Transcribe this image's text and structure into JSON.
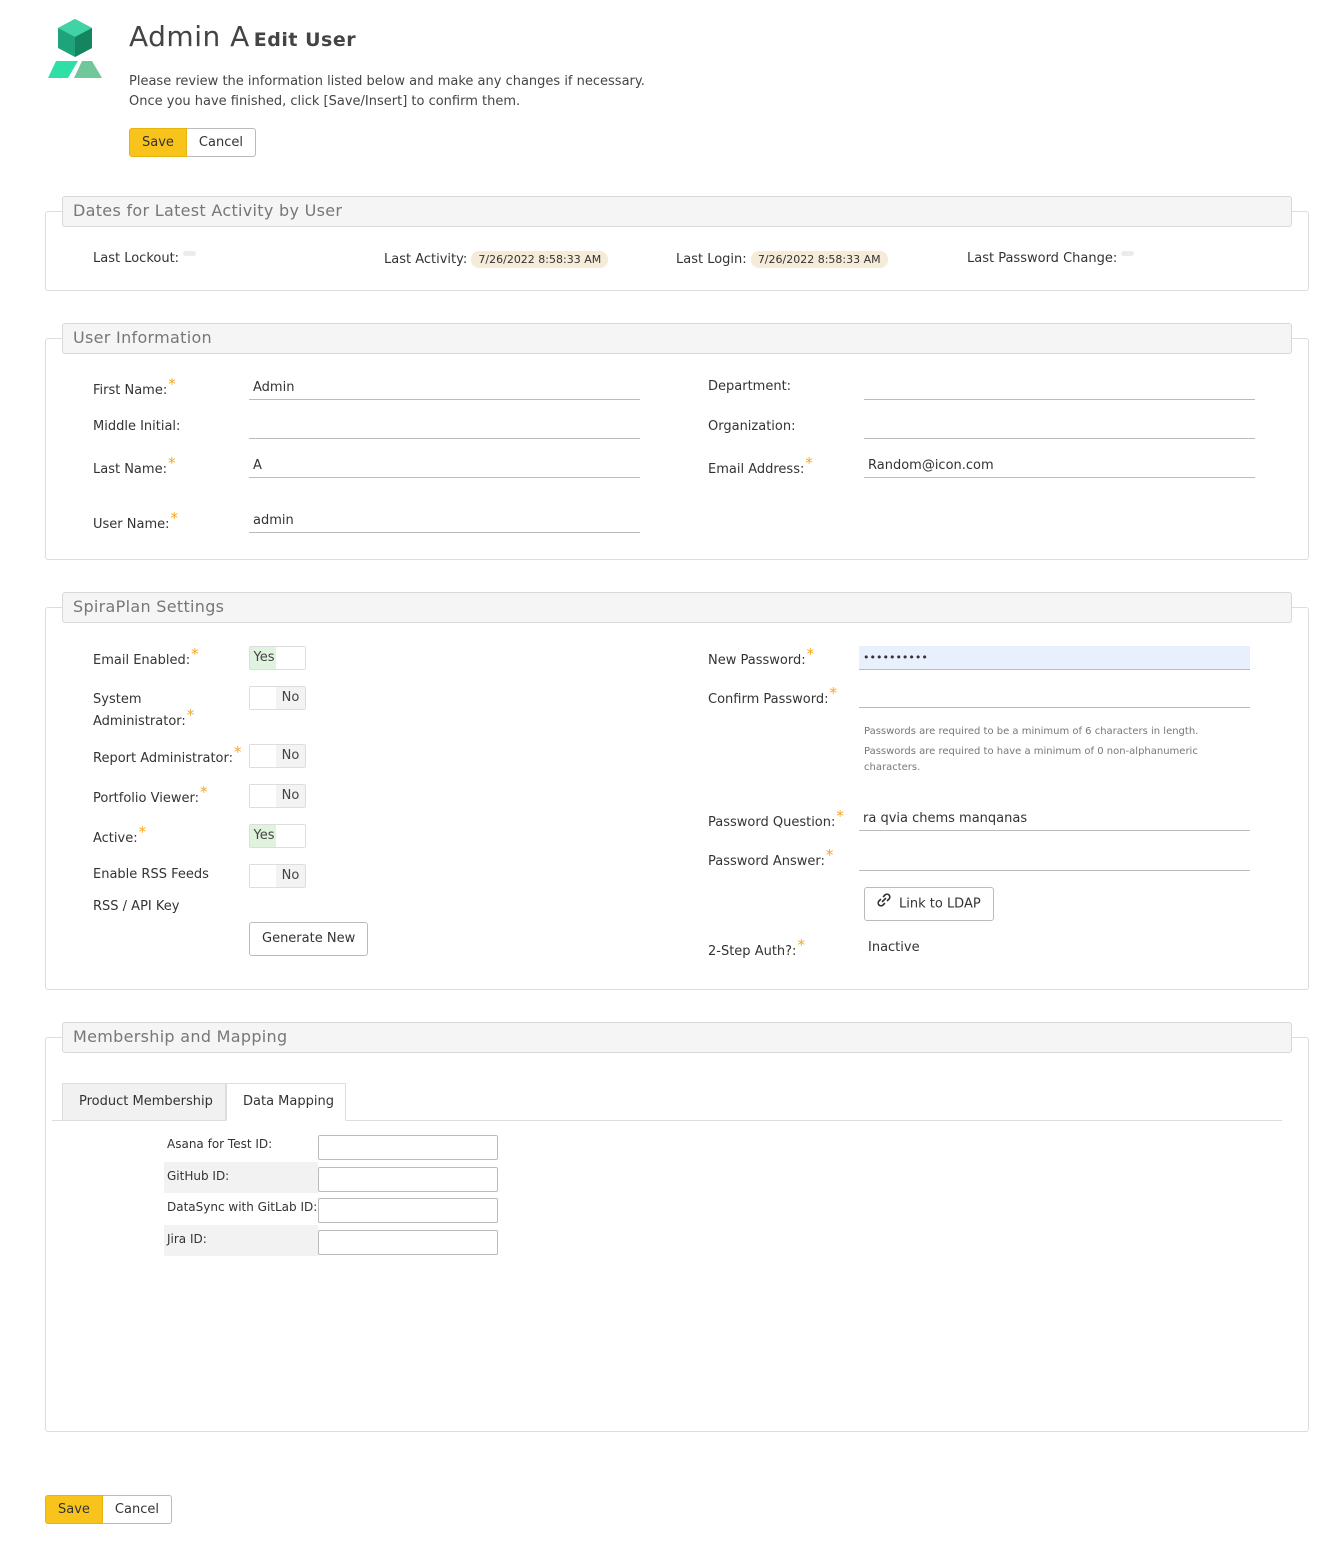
{
  "header": {
    "title": "Admin A",
    "subtitle": "Edit User",
    "intro_line1": "Please review the information listed below and make any changes if necessary.",
    "intro_line2": "Once you have finished, click [Save/Insert] to confirm them.",
    "save_label": "Save",
    "cancel_label": "Cancel"
  },
  "colors": {
    "accent": "#f8c41c",
    "required": "#f5a623",
    "logo_green": "#2fc19a"
  },
  "activity": {
    "legend": "Dates for Latest Activity by User",
    "last_lockout_label": "Last Lockout:",
    "last_activity_label": "Last Activity:",
    "last_activity_value": "7/26/2022 8:58:33 AM",
    "last_login_label": "Last Login:",
    "last_login_value": "7/26/2022 8:58:33 AM",
    "last_password_change_label": "Last Password Change:"
  },
  "user_info": {
    "legend": "User Information",
    "first_name_label": "First Name:",
    "first_name_value": "Admin",
    "middle_initial_label": "Middle Initial:",
    "middle_initial_value": "",
    "last_name_label": "Last Name:",
    "last_name_value": "A",
    "user_name_label": "User Name:",
    "user_name_value": "admin",
    "department_label": "Department:",
    "department_value": "",
    "organization_label": "Organization:",
    "organization_value": "",
    "email_label": "Email Address:",
    "email_value": "Random@icon.com"
  },
  "settings": {
    "legend": "SpiraPlan Settings",
    "email_enabled_label": "Email Enabled:",
    "email_enabled_value": "Yes",
    "sysadmin_label_1": "System",
    "sysadmin_label_2": "Administrator:",
    "sysadmin_value": "No",
    "report_admin_label": "Report Administrator:",
    "report_admin_value": "No",
    "portfolio_viewer_label": "Portfolio Viewer:",
    "portfolio_viewer_value": "No",
    "active_label": "Active:",
    "active_value": "Yes",
    "rss_label": "Enable RSS Feeds",
    "rss_value": "No",
    "rss_key_label": "RSS / API Key",
    "generate_new_label": "Generate New",
    "new_password_label": "New Password:",
    "new_password_value": "••••••••••",
    "confirm_password_label": "Confirm Password:",
    "confirm_password_value": "",
    "hint_length": "Passwords are required to be a minimum of 6 characters in length.",
    "hint_nonalpha_1": "Passwords are required to have a minimum of 0 non-alphanumeric",
    "hint_nonalpha_2": "characters.",
    "password_question_label": "Password Question:",
    "password_question_value": "ra qvia chems manqanas",
    "password_answer_label": "Password Answer:",
    "password_answer_value": "",
    "link_ldap_label": "Link to LDAP",
    "two_step_label": "2-Step Auth?:",
    "two_step_value": "Inactive"
  },
  "membership": {
    "legend": "Membership and Mapping",
    "tabs": [
      {
        "label": "Product Membership",
        "active": false
      },
      {
        "label": "Data Mapping",
        "active": true
      }
    ],
    "mappings": [
      {
        "label": "Asana for Test ID:",
        "value": ""
      },
      {
        "label": "GitHub ID:",
        "value": ""
      },
      {
        "label": "DataSync with GitLab ID:",
        "value": ""
      },
      {
        "label": "Jira ID:",
        "value": ""
      }
    ]
  },
  "footer": {
    "save_label": "Save",
    "cancel_label": "Cancel"
  }
}
